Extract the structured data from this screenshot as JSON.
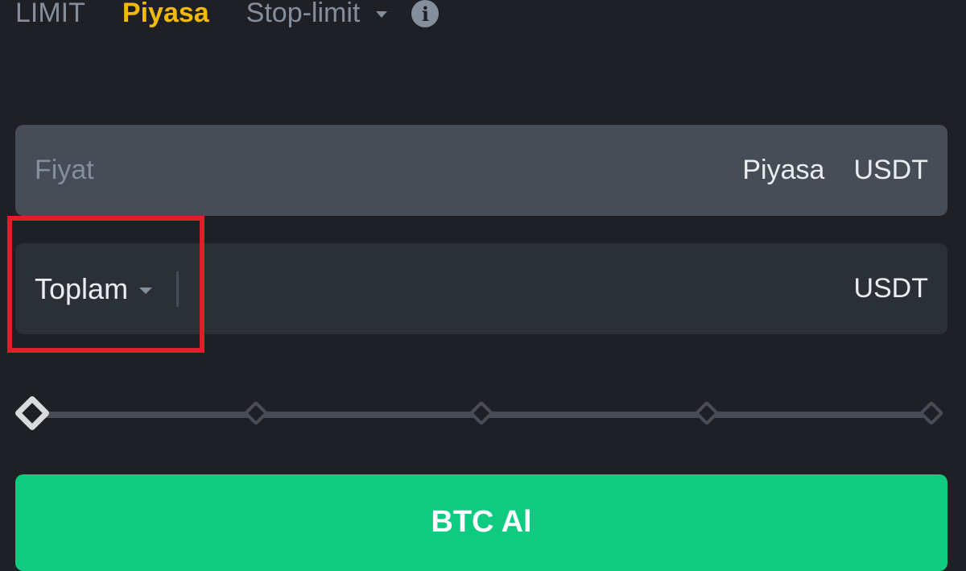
{
  "tabs": {
    "limit": "LIMIT",
    "market": "Piyasa",
    "stop_limit": "Stop-limit",
    "info_icon_glyph": "i",
    "active": "market"
  },
  "price_field": {
    "placeholder": "Fiyat",
    "value": "Piyasa",
    "unit": "USDT"
  },
  "total_field": {
    "selector_label": "Toplam",
    "value": "",
    "unit": "USDT"
  },
  "slider": {
    "value_percent": 0,
    "steps": [
      0,
      25,
      50,
      75,
      100
    ]
  },
  "buy_button": {
    "label": "BTC Al"
  },
  "colors": {
    "background": "#1e2026",
    "accent": "#f0b90b",
    "buy": "#0ecb81",
    "highlight": "#e11d2a"
  }
}
